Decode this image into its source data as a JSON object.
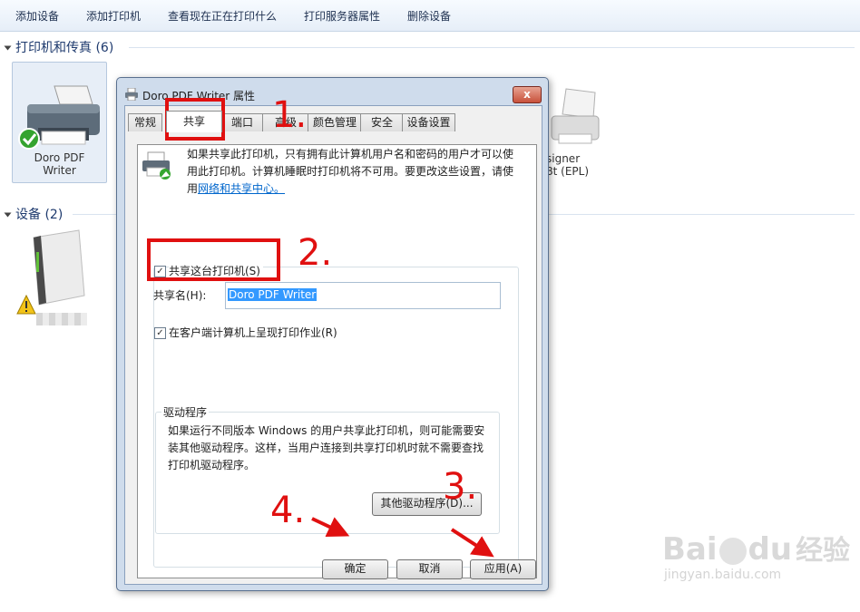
{
  "command_bar": {
    "items": [
      "添加设备",
      "添加打印机",
      "查看现在正在打印什么",
      "打印服务器属性",
      "删除设备"
    ]
  },
  "printers_group": {
    "title": "打印机和传真 (6)",
    "tile_left_label_line1": "Doro PDF",
    "tile_left_label_line2": "Writer",
    "tile_right_label_line1": "signer",
    "tile_right_label_line2": "8t (EPL)"
  },
  "devices_group": {
    "title": "设备 (2)"
  },
  "dialog": {
    "title": "Doro PDF Writer 属性",
    "close_glyph": "x",
    "tabs": [
      "常规",
      "共享",
      "端口",
      "高级",
      "颜色管理",
      "安全",
      "设备设置"
    ],
    "active_tab": "共享",
    "info_line1": "如果共享此打印机，只有拥有此计算机用户名和密码的用户才可以使",
    "info_line2": "用此打印机。计算机睡眠时打印机将不可用。要更改这些设置，请使",
    "info_line3_prefix": "用",
    "info_link": "网络和共享中心。",
    "share_checkbox_label": "共享这台打印机(S)",
    "share_checked": true,
    "share_name_label": "共享名(H):",
    "share_name_value": "Doro PDF Writer",
    "render_jobs_label": "在客户端计算机上呈现打印作业(R)",
    "render_jobs_checked": true,
    "drivers_group_title": "驱动程序",
    "drivers_line1": "如果运行不同版本 Windows 的用户共享此打印机，则可能需要安",
    "drivers_line2": "装其他驱动程序。这样，当用户连接到共享打印机时就不需要查找",
    "drivers_line3": "打印机驱动程序。",
    "additional_drivers_button": "其他驱动程序(D)...",
    "ok_button": "确定",
    "cancel_button": "取消",
    "apply_button": "应用(A)"
  },
  "annotations": {
    "step1": "1.",
    "step2": "2.",
    "step3": "3.",
    "step4": "4."
  },
  "watermark": {
    "brand_latin1": "Bai",
    "brand_latin2": "du",
    "brand_cn": "经验",
    "url": "jingyan.baidu.com"
  },
  "colors": {
    "annotation_red": "#e01010",
    "link_blue": "#0066cc",
    "selection_blue": "#3399ff"
  }
}
